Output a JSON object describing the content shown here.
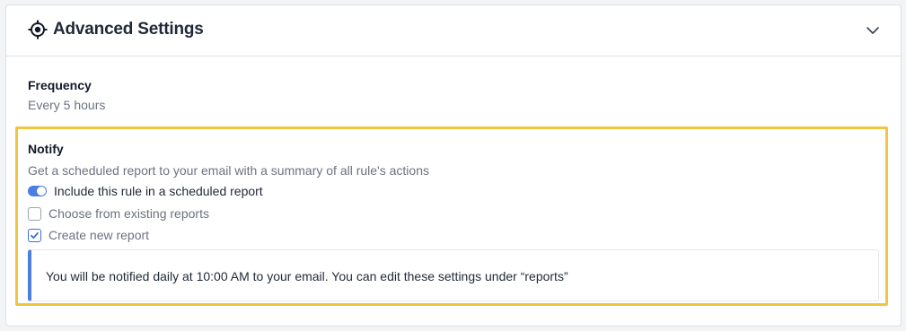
{
  "header": {
    "title": "Advanced Settings"
  },
  "frequency": {
    "label": "Frequency",
    "value": "Every 5 hours"
  },
  "notify": {
    "title": "Notify",
    "description": "Get a scheduled report to your email with a summary of all rule's actions",
    "toggle": {
      "label": "Include this rule in a scheduled report",
      "on": true
    },
    "options": [
      {
        "label": "Choose from existing reports",
        "checked": false
      },
      {
        "label": "Create new report",
        "checked": true
      }
    ],
    "info": "You will be notified daily at 10:00 AM to your email. You can edit these settings under “reports”"
  },
  "colors": {
    "accent": "#4a7ee0",
    "highlight_border": "#f0c542"
  }
}
